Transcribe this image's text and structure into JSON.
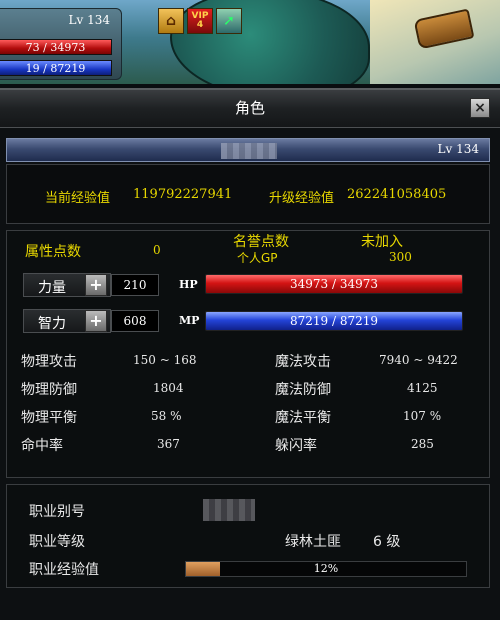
{
  "hud": {
    "level": "Lv 134",
    "hp_text": "73 / 34973",
    "mp_text": "19 / 87219",
    "vip_label": "VIP",
    "vip_level": "4"
  },
  "window": {
    "title": "角色",
    "close_label": "×",
    "player_level": "Lv 134"
  },
  "experience": {
    "current_label": "当前经验值",
    "current_value": "119792227941",
    "next_label": "升级经验值",
    "next_value": "262241058405"
  },
  "attributes": {
    "attr_points_label": "属性点数",
    "attr_points_value": "0",
    "honor_label": "名誉点数",
    "personal_gp_label": "个人GP",
    "guild_status": "未加入",
    "gp_value": "300",
    "strength_label": "力量",
    "strength_value": "210",
    "hp_tag": "HP",
    "hp_text": "34973 / 34973",
    "intelligence_label": "智力",
    "intelligence_value": "608",
    "mp_tag": "MP",
    "mp_text": "87219 / 87219",
    "plus_label": "+"
  },
  "combat": {
    "phys_atk_label": "物理攻击",
    "phys_atk_value": "150 ~ 168",
    "mag_atk_label": "魔法攻击",
    "mag_atk_value": "7940 ~ 9422",
    "phys_def_label": "物理防御",
    "phys_def_value": "1804",
    "mag_def_label": "魔法防御",
    "mag_def_value": "4125",
    "phys_bal_label": "物理平衡",
    "phys_bal_value": "58 %",
    "mag_bal_label": "魔法平衡",
    "mag_bal_value": "107 %",
    "hit_label": "命中率",
    "hit_value": "367",
    "dodge_label": "躲闪率",
    "dodge_value": "285"
  },
  "job": {
    "alias_label": "职业别号",
    "level_label": "职业等级",
    "job_name": "绿林土匪",
    "job_level": "6 级",
    "exp_label": "职业经验值",
    "exp_percent_text": "12%",
    "exp_fraction": 0.12
  },
  "colors": {
    "label_yellow": "#e8d800",
    "hp_red": "#d41414",
    "mp_blue": "#2444d8"
  }
}
